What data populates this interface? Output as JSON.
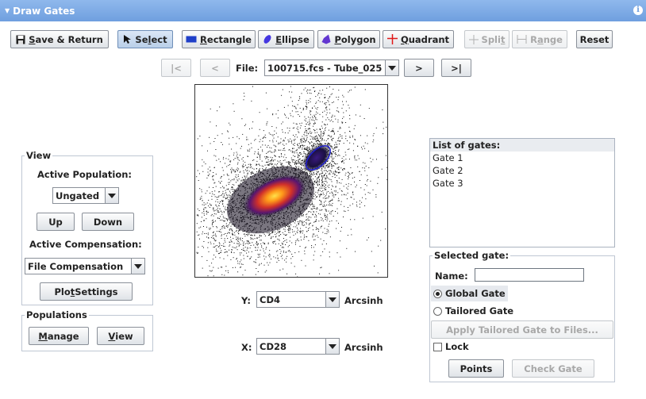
{
  "panel": {
    "title": "Draw Gates",
    "collapse_icon": "triangle-down-icon",
    "info_icon": "info-icon"
  },
  "toolbar": {
    "save_return": {
      "pre": "",
      "u": "S",
      "post": "ave & Return"
    },
    "select": {
      "pre": "Se",
      "u": "l",
      "post": "ect"
    },
    "rectangle": {
      "pre": "",
      "u": "R",
      "post": "ectangle"
    },
    "ellipse": {
      "pre": "",
      "u": "E",
      "post": "llipse"
    },
    "polygon": {
      "pre": "",
      "u": "P",
      "post": "olygon"
    },
    "quadrant": {
      "pre": "",
      "u": "Q",
      "post": "uadrant"
    },
    "split": {
      "pre": "Spli",
      "u": "t",
      "post": ""
    },
    "range": {
      "pre": "R",
      "u": "a",
      "post": "nge"
    },
    "reset": "Reset"
  },
  "file_nav": {
    "first": "|<",
    "prev": "<",
    "label": "File:",
    "file_value": "100715.fcs - Tube_025",
    "next": ">",
    "last": ">|"
  },
  "view": {
    "title": "View",
    "active_population_label": "Active Population:",
    "active_population_value": "Ungated",
    "up": "Up",
    "down": "Down",
    "active_compensation_label": "Active Compensation:",
    "active_compensation_value": "File Compensation",
    "plot_settings": {
      "pre": "Plo",
      "u": "t",
      "post": " Settings"
    }
  },
  "populations": {
    "title": "Populations",
    "manage": {
      "pre": "",
      "u": "M",
      "post": "anage"
    },
    "view": {
      "pre": "",
      "u": "V",
      "post": "iew"
    }
  },
  "axes": {
    "y_label": "Y:",
    "y_value": "CD4",
    "y_transform": "Arcsinh",
    "x_label": "X:",
    "x_value": "CD28",
    "x_transform": "Arcsinh"
  },
  "gates_list": {
    "title": "List of gates:",
    "items": [
      "Gate 1",
      "Gate 2",
      "Gate 3"
    ]
  },
  "selected_gate": {
    "title": "Selected gate:",
    "name_label": "Name:",
    "name_value": "",
    "global_gate": "Global Gate",
    "global_selected": true,
    "tailored_gate": "Tailored Gate",
    "tailored_selected": false,
    "apply_tailored": "Apply Tailored Gate to Files...",
    "lock": "Lock",
    "lock_checked": false,
    "points": "Points",
    "check_gate": "Check Gate"
  },
  "colors": {
    "accent": "#6f9fdf",
    "rect_icon": "#1f3fc8",
    "ellipse_icon": "#4436e0",
    "polygon_icon": "#6236d0",
    "quadrant_icon": "#e01818",
    "gate_outline": "#2020d0"
  }
}
